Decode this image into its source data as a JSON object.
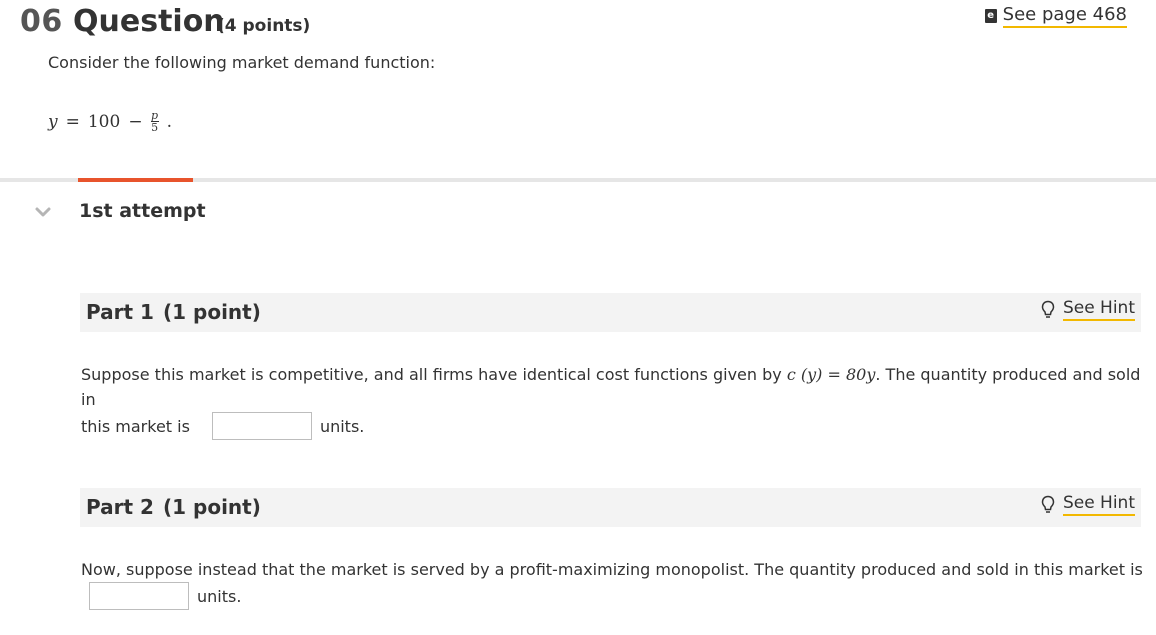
{
  "question": {
    "number": "06",
    "title": "Question",
    "points": "(4 points)",
    "see_page": "See page 468",
    "intro": "Consider the following market demand function:",
    "equation": {
      "lhs": "y",
      "rhs_const": "100",
      "frac_num": "p",
      "frac_den": "5"
    }
  },
  "attempt": {
    "label": "1st attempt"
  },
  "parts": [
    {
      "label": "Part 1",
      "points": "(1 point)",
      "hint": "See Hint",
      "text_before": "Suppose this market is competitive, and all firms have identical cost functions given by ",
      "cost_fn": "c (y) = 80y",
      "text_after": ". The quantity produced and sold in",
      "line2_before": "this market is",
      "units": "units."
    },
    {
      "label": "Part 2",
      "points": "(1 point)",
      "hint": "See Hint",
      "text": "Now, suppose instead that the market is served by a profit-maximizing monopolist. The quantity produced and sold in this market is",
      "units": "units."
    }
  ],
  "colors": {
    "accent_orange": "#e8542c",
    "link_underline": "#f2b800",
    "part_bg": "#f3f3f3"
  }
}
